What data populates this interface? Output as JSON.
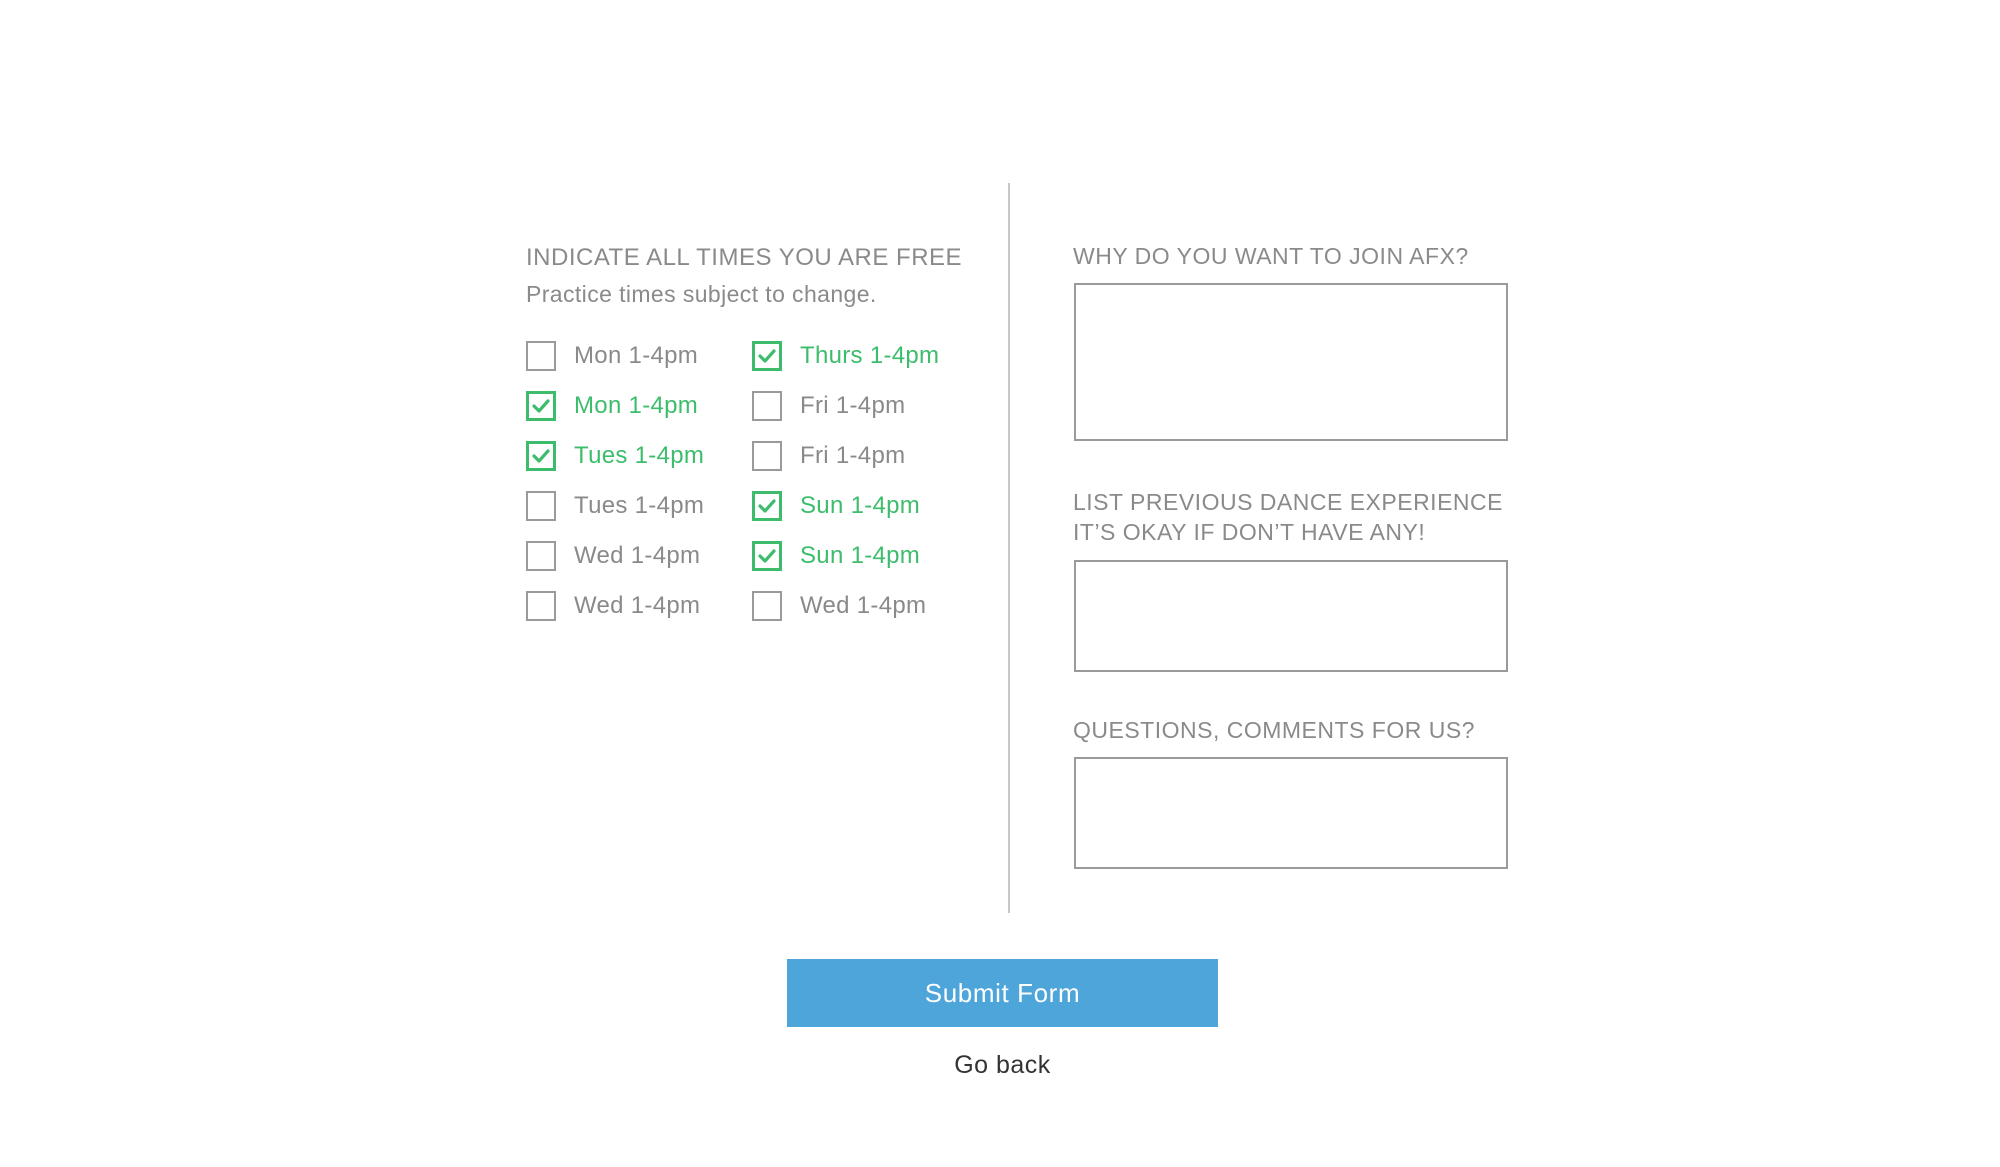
{
  "availability": {
    "heading": "INDICATE ALL TIMES YOU ARE FREE",
    "subheading": "Practice times subject to change.",
    "left_column": [
      {
        "label": "Mon 1-4pm",
        "checked": false
      },
      {
        "label": "Mon 1-4pm",
        "checked": true
      },
      {
        "label": "Tues 1-4pm",
        "checked": true
      },
      {
        "label": "Tues 1-4pm",
        "checked": false
      },
      {
        "label": "Wed 1-4pm",
        "checked": false
      },
      {
        "label": "Wed 1-4pm",
        "checked": false
      }
    ],
    "right_column": [
      {
        "label": "Thurs 1-4pm",
        "checked": true
      },
      {
        "label": "Fri 1-4pm",
        "checked": false
      },
      {
        "label": "Fri 1-4pm",
        "checked": false
      },
      {
        "label": "Sun 1-4pm",
        "checked": true
      },
      {
        "label": "Sun 1-4pm",
        "checked": true
      },
      {
        "label": "Wed 1-4pm",
        "checked": false
      }
    ]
  },
  "questions": {
    "why_join": {
      "label": "WHY DO YOU WANT TO JOIN AFX?",
      "value": ""
    },
    "experience": {
      "label_line1": "LIST PREVIOUS DANCE EXPERIENCE",
      "label_line2": "IT’S OKAY IF DON’T HAVE ANY!",
      "value": ""
    },
    "comments": {
      "label": "QUESTIONS, COMMENTS FOR US?",
      "value": ""
    }
  },
  "actions": {
    "submit_label": "Submit Form",
    "back_label": "Go back"
  },
  "colors": {
    "accent_checked": "#3dbd6c",
    "submit_button": "#4ea5da",
    "text_muted": "#8a8a8a"
  },
  "icons": {
    "checked": "checkmark-icon"
  }
}
